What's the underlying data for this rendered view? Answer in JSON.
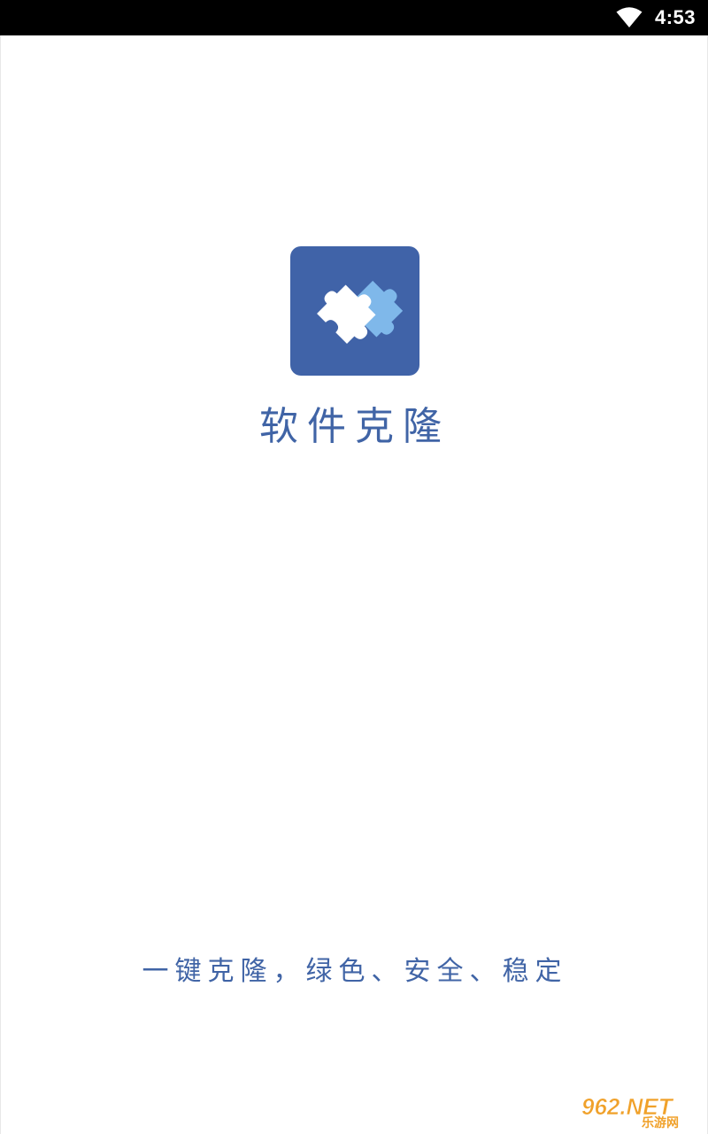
{
  "status_bar": {
    "time": "4:53",
    "wifi_icon": "wifi-icon"
  },
  "splash": {
    "app_icon": "puzzle-piece-icon",
    "title": "软件克隆",
    "slogan": "一键克隆，绿色、安全、稳定"
  },
  "watermark": {
    "brand": "962.NET",
    "brand_cn": "乐游网"
  },
  "colors": {
    "status_bar_bg": "#000000",
    "icon_bg": "#4063a8",
    "text_blue": "#4064a6",
    "puzzle_light": "#7fb8ea",
    "watermark_orange": "#f0a12a"
  }
}
